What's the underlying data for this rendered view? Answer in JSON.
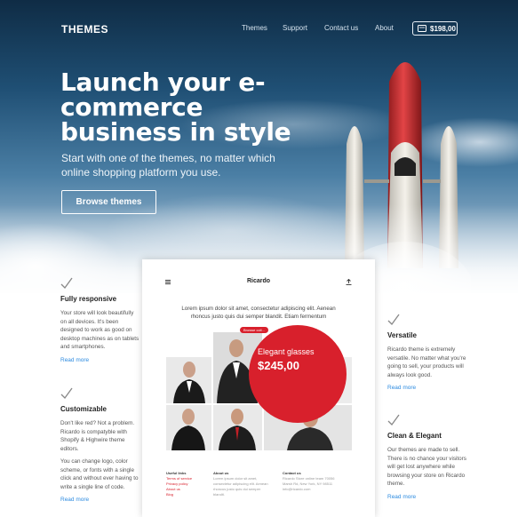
{
  "header": {
    "logo": "THEMES",
    "nav": [
      {
        "label": "Themes"
      },
      {
        "label": "Support"
      },
      {
        "label": "Contact us"
      },
      {
        "label": "About"
      }
    ],
    "cart_total": "$198,00"
  },
  "hero": {
    "headline": "Launch your e-commerce business in style",
    "subline": "Start with one of the themes, no matter which online shopping platform you use.",
    "cta": "Browse themes"
  },
  "features_left": [
    {
      "title": "Fully responsive",
      "desc": "Your store will look beautifully on all devices. It's been designed to work as good on desktop machines as on tablets and smartphones.",
      "more": "Read more"
    },
    {
      "title": "Customizable",
      "desc": "Don't like red? Not a problem. Ricardo is compatyble with Shopify & Highwire theme editors.",
      "desc2": "You can change logo, color scheme, or fonts with a single click and without ever having to write a single line of code.",
      "more": "Read more"
    }
  ],
  "features_right": [
    {
      "title": "Versatile",
      "desc": "Ricardo theme is extremely versatile. No matter what you're going to sell, your products will always look good.",
      "more": "Read more"
    },
    {
      "title": "Clean & Elegant",
      "desc": "Our themes are made to sell. There is no chance your visitors will get lost anywhere while browsing your store on Ricardo theme.",
      "more": "Read more"
    }
  ],
  "mockup": {
    "brand": "Ricardo",
    "lorem": "Lorem ipsum dolor sit amet, consectetur adipiscing elit. Aenean rhoncus justo quis dui semper blandit. Etiam fermentum",
    "pill": "Browse coll...",
    "promo_title": "Elegant glasses",
    "promo_price": "$245,00",
    "footer": {
      "col1_title": "Useful links",
      "col1_items": [
        "Terms of service",
        "Privacy policy",
        "About us",
        "Blog"
      ],
      "col2_title": "About us",
      "col2_text": "Lorem ipsum dolor sit amet, consectetur adipiscing elit. Aenean rhoncus justo quis dui semper blandit.",
      "col3_title": "Contact us",
      "col3_text": "Ricardo Store online team 70056 Marsh Rd, New York, NY 98511 info@ricardo.com"
    }
  },
  "colors": {
    "accent": "#d8202c",
    "link": "#2d8be0"
  }
}
